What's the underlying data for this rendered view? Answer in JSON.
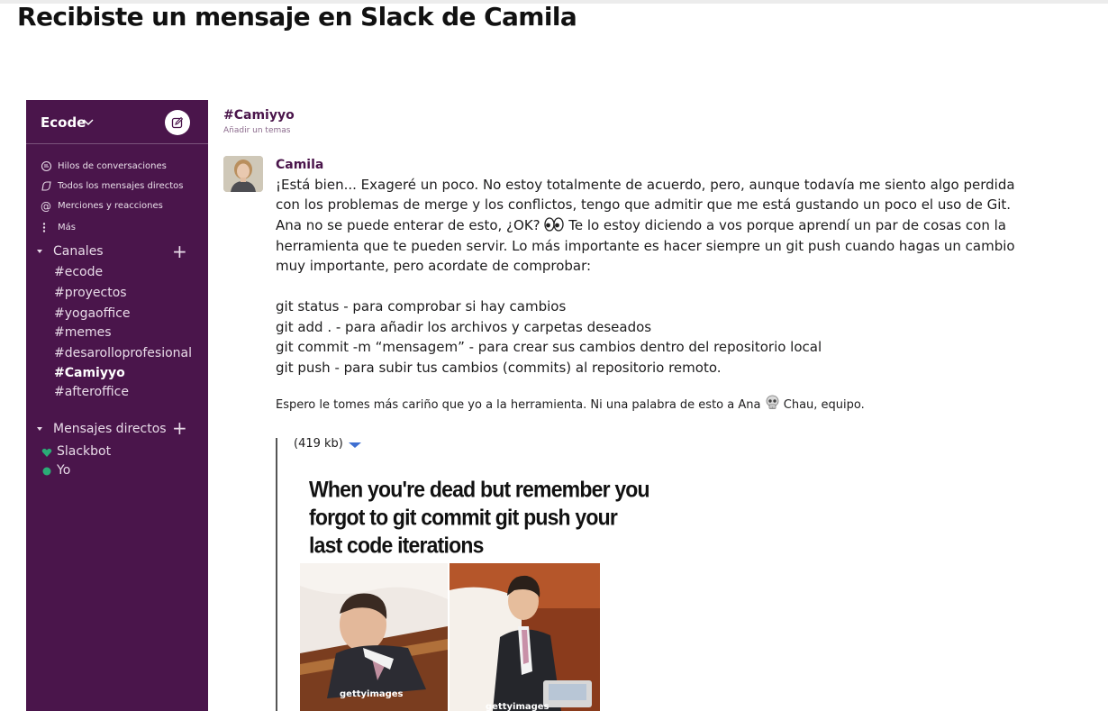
{
  "page": {
    "heading": "Recibiste un mensaje en Slack de Camila"
  },
  "sidebar": {
    "workspace": "Ecode",
    "nav": [
      {
        "icon": "threads-icon",
        "label": "Hilos de conversaciones"
      },
      {
        "icon": "direct-messages-icon",
        "label": "Todos los mensajes directos"
      },
      {
        "icon": "mentions-icon",
        "label": "Merciones y reacciones"
      },
      {
        "icon": "more-icon",
        "label": "Más"
      }
    ],
    "channels_title": "Canales",
    "channels": [
      {
        "label": "#ecode",
        "active": false
      },
      {
        "label": "#proyectos",
        "active": false
      },
      {
        "label": "#yogaoffice",
        "active": false
      },
      {
        "label": "#memes",
        "active": false
      },
      {
        "label": "#desarolloprofesional",
        "active": false
      },
      {
        "label": "#Camiyyo",
        "active": true
      },
      {
        "label": "#afteroffice",
        "active": false
      }
    ],
    "dms_title": "Mensajes directos",
    "dms": [
      {
        "label": "Slackbot",
        "icon": "heart-icon",
        "color": "#2bac76"
      },
      {
        "label": "Yo",
        "icon": "presence-dot-icon",
        "color": "#2bac76"
      }
    ]
  },
  "channel": {
    "name": "#Camiyyo",
    "topic": "Añadir un temas"
  },
  "message": {
    "author": "Camila",
    "lines": [
      "¡Está bien... Exageré un poco. No estoy totalmente de acuerdo, pero, aunque todavía me siento algo perdida",
      "con los problemas de merge y los conflictos, tengo que admitir que me está gustando un poco el uso de Git.",
      "Ana no se puede enterar de esto, ¿OK?",
      "Te lo estoy diciendo a vos porque aprendí un par de cosas con la",
      "herramienta que te pueden servir. Lo más importante es hacer siempre un git push cuando hagas un cambio",
      "muy importante, pero acordate de comprobar:"
    ],
    "commands": [
      "git status - para comprobar si hay cambios",
      "git add . - para añadir los archivos y carpetas deseados",
      "git commit -m “mensagem” - para crear sus cambios dentro del repositorio local",
      "git push - para subir tus cambios (commits) al repositorio remoto."
    ],
    "closing_a": "Espero le tomes más cariño que yo a la herramienta. Ni una palabra de esto a Ana",
    "closing_b": "Chau, equipo."
  },
  "attachment": {
    "size": "(419 kb)",
    "meme_caption": [
      "When you're dead but remember you",
      "forgot to git commit git push your",
      "last code iterations"
    ],
    "watermark": "gettyimages"
  },
  "colors": {
    "sidebar": "#4a154b",
    "accent": "#4a154b",
    "presence": "#2bac76",
    "link": "#3f6fd1"
  }
}
